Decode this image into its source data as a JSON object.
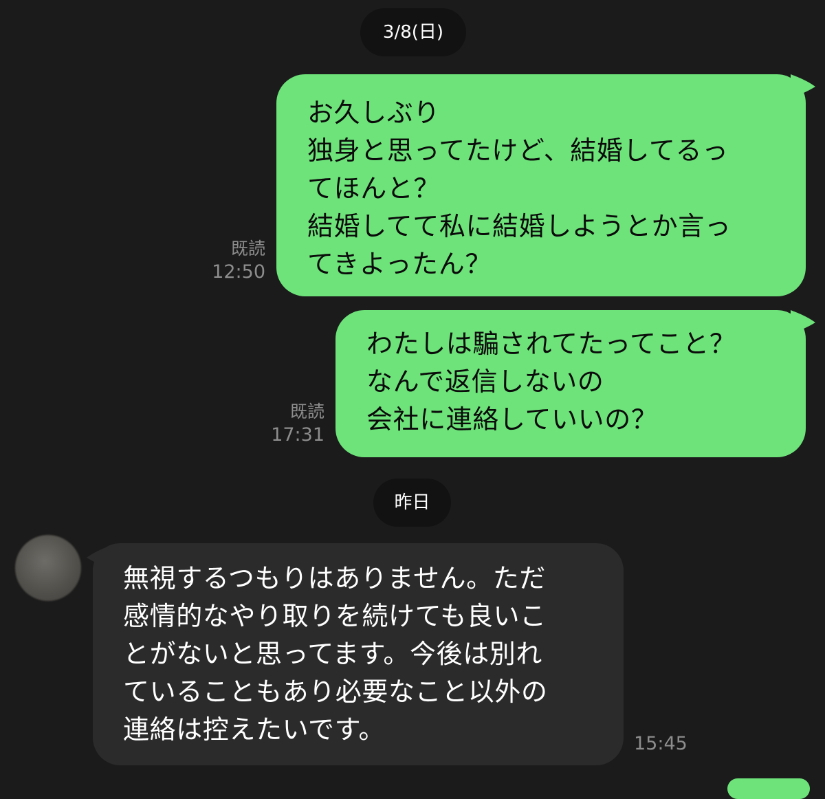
{
  "chat": {
    "date_separators": [
      "3/8(日)",
      "昨日"
    ],
    "messages": [
      {
        "direction": "outgoing",
        "read_label": "既読",
        "time": "12:50",
        "lines": [
          "お久しぶり",
          "独身と思ってたけど、結婚してるっ",
          "てほんと？",
          "結婚してて私に結婚しようとか言っ",
          "てきよったん？"
        ]
      },
      {
        "direction": "outgoing",
        "read_label": "既読",
        "time": "17:31",
        "lines": [
          "わたしは騙されてたってこと？",
          "なんで返信しないの",
          "会社に連絡していいの？"
        ]
      },
      {
        "direction": "incoming",
        "time": "15:45",
        "lines": [
          "無視するつもりはありません。ただ",
          "感情的なやり取りを続けても良いこ",
          "とがないと思ってます。今後は別れ",
          "ていることもあり必要なこと以外の",
          "連絡は控えたいです。"
        ]
      }
    ]
  },
  "colors": {
    "background": "#1b1b1b",
    "outgoing_bubble": "#6de37a",
    "incoming_bubble": "#2b2b2b",
    "meta_text": "#8d8d8d"
  }
}
